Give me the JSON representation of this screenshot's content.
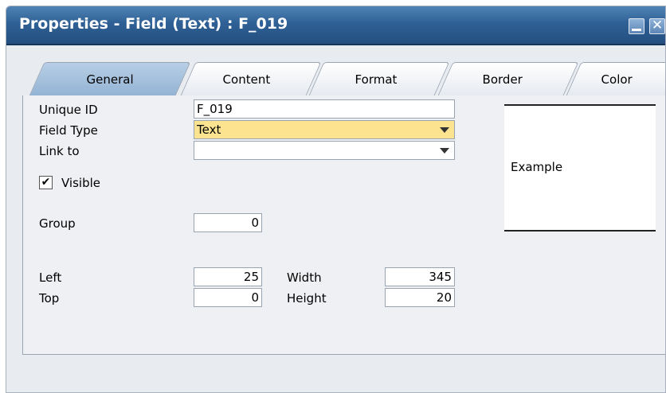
{
  "window": {
    "title": "Properties - Field (Text) : F_019",
    "minimize_glyph": "",
    "close_glyph": "✕"
  },
  "tabs": [
    {
      "label": "General",
      "active": true
    },
    {
      "label": "Content",
      "active": false
    },
    {
      "label": "Format",
      "active": false
    },
    {
      "label": "Border",
      "active": false
    },
    {
      "label": "Color",
      "active": false
    }
  ],
  "general": {
    "unique_id_label": "Unique ID",
    "unique_id_value": "F_019",
    "field_type_label": "Field Type",
    "field_type_value": "Text",
    "link_to_label": "Link to",
    "link_to_value": "",
    "visible_label": "Visible",
    "visible_checked": true,
    "group_label": "Group",
    "group_value": "0",
    "left_label": "Left",
    "left_value": "25",
    "top_label": "Top",
    "top_value": "0",
    "width_label": "Width",
    "width_value": "345",
    "height_label": "Height",
    "height_value": "20",
    "example_text": "Example"
  },
  "colors": {
    "titlebar": "#2f6095",
    "active_tab": "#a9c3e0",
    "field_highlight": "#fbe38f"
  }
}
